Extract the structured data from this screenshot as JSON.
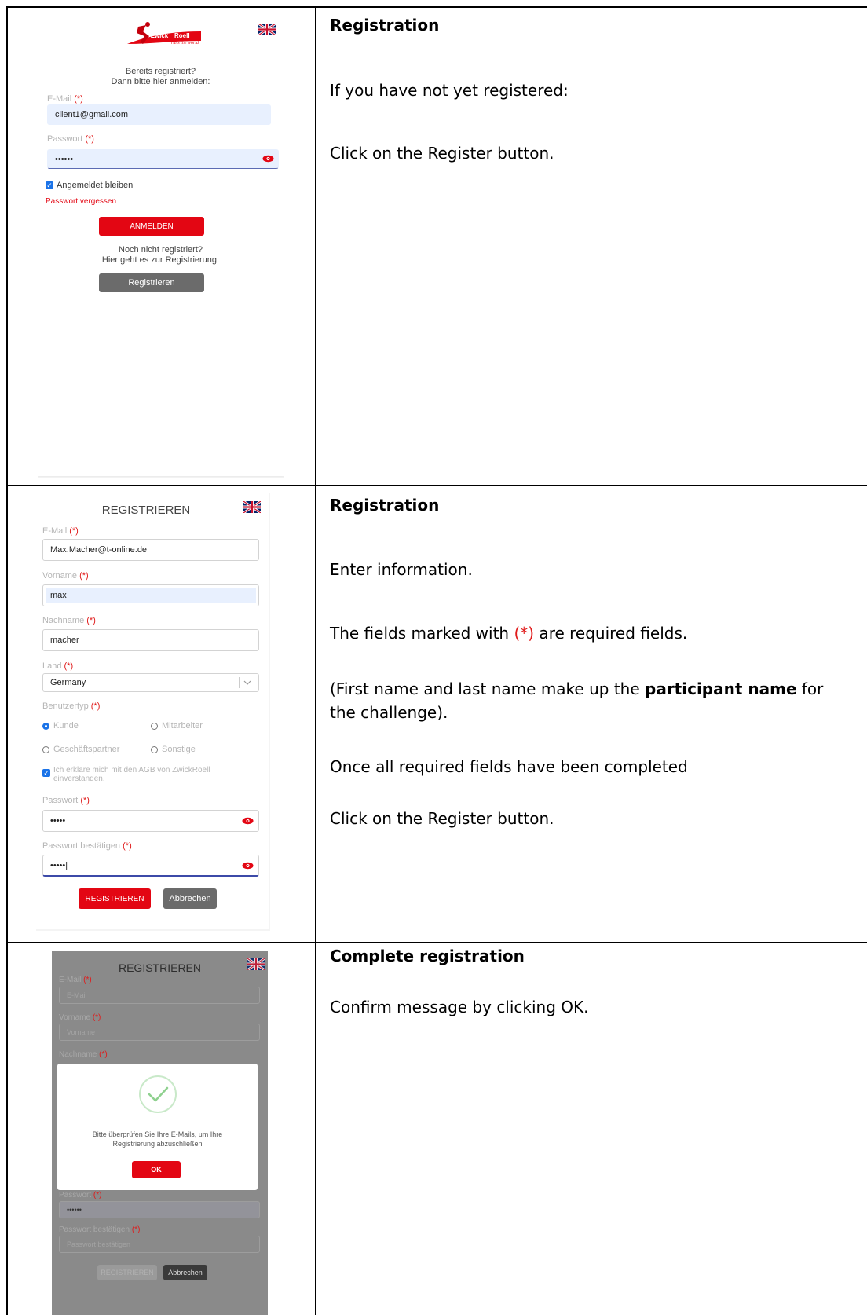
{
  "rows": [
    {
      "heading": "Registration",
      "paragraphs": [
        "If you have not yet registered:",
        "Click on the Register button."
      ]
    },
    {
      "heading": "Registration",
      "p1": "Enter information.",
      "p2_before": "The fields marked with ",
      "p2_mark": "(*)",
      "p2_after": " are required fields.",
      "p3_before": "(First name and last name make up the ",
      "p3_bold": "participant name",
      "p3_after_line1": " for",
      "p3_line2": "the challenge).",
      "p4": "Once all required fields have been completed",
      "p5": "Click on the Register button."
    },
    {
      "heading": "Complete registration",
      "paragraphs": [
        "Confirm message by clicking OK."
      ]
    }
  ],
  "login": {
    "logo_text_1": "Zwick",
    "logo_text_2": "Roell",
    "logo_tagline": "runs the world",
    "intro_line1": "Bereits registriert?",
    "intro_line2": "Dann bitte hier anmelden:",
    "email_label": "E-Mail",
    "required_mark": "(*)",
    "email_value": "client1@gmail.com",
    "password_label": "Passwort",
    "password_value": "••••••",
    "remember_label": "Angemeldet bleiben",
    "forgot_link": "Passwort vergessen",
    "login_button": "ANMELDEN",
    "register_intro_line1": "Noch nicht registriert?",
    "register_intro_line2": "Hier geht es zur Registrierung:",
    "register_button": "Registrieren"
  },
  "register": {
    "title": "REGISTRIEREN",
    "email_label": "E-Mail",
    "required_mark": "(*)",
    "email_value": "Max.Macher@t-online.de",
    "firstname_label": "Vorname",
    "firstname_value": "max",
    "lastname_label": "Nachname",
    "lastname_value": "macher",
    "country_label": "Land",
    "country_value": "Germany",
    "usertype_label": "Benutzertyp",
    "usertype_options": [
      "Kunde",
      "Mitarbeiter",
      "Geschäftspartner",
      "Sonstige"
    ],
    "terms_line1": "Ich erkläre mich mit den AGB von ZwickRoell",
    "terms_line2": "einverstanden.",
    "password_label": "Passwort",
    "password_value": "•••••",
    "confirm_label": "Passwort bestätigen",
    "confirm_value": "•••••|",
    "submit_button": "REGISTRIEREN",
    "cancel_button": "Abbrechen"
  },
  "complete": {
    "title": "REGISTRIEREN",
    "required_mark": "(*)",
    "email_label": "E-Mail",
    "email_placeholder": "E-Mail",
    "firstname_label": "Vorname",
    "firstname_placeholder": "Vorname",
    "lastname_label": "Nachname",
    "password_label": "Passwort",
    "password_value": "••••••",
    "confirm_label": "Passwort bestätigen",
    "confirm_placeholder": "Passwort bestätigen",
    "submit_button": "REGISTRIEREN",
    "cancel_button": "Abbrechen",
    "dialog_line1": "Bitte überprüfen Sie Ihre E-Mails, um Ihre",
    "dialog_line2": "Registrierung abzuschließen",
    "ok_button": "OK"
  },
  "colors": {
    "accent_red": "#e30613",
    "grey_button": "#6b6b6b",
    "check_green": "#8fd18f"
  },
  "icons": [
    "uk-flag-icon",
    "eye-icon",
    "check-circle-icon",
    "chevron-down-icon"
  ]
}
